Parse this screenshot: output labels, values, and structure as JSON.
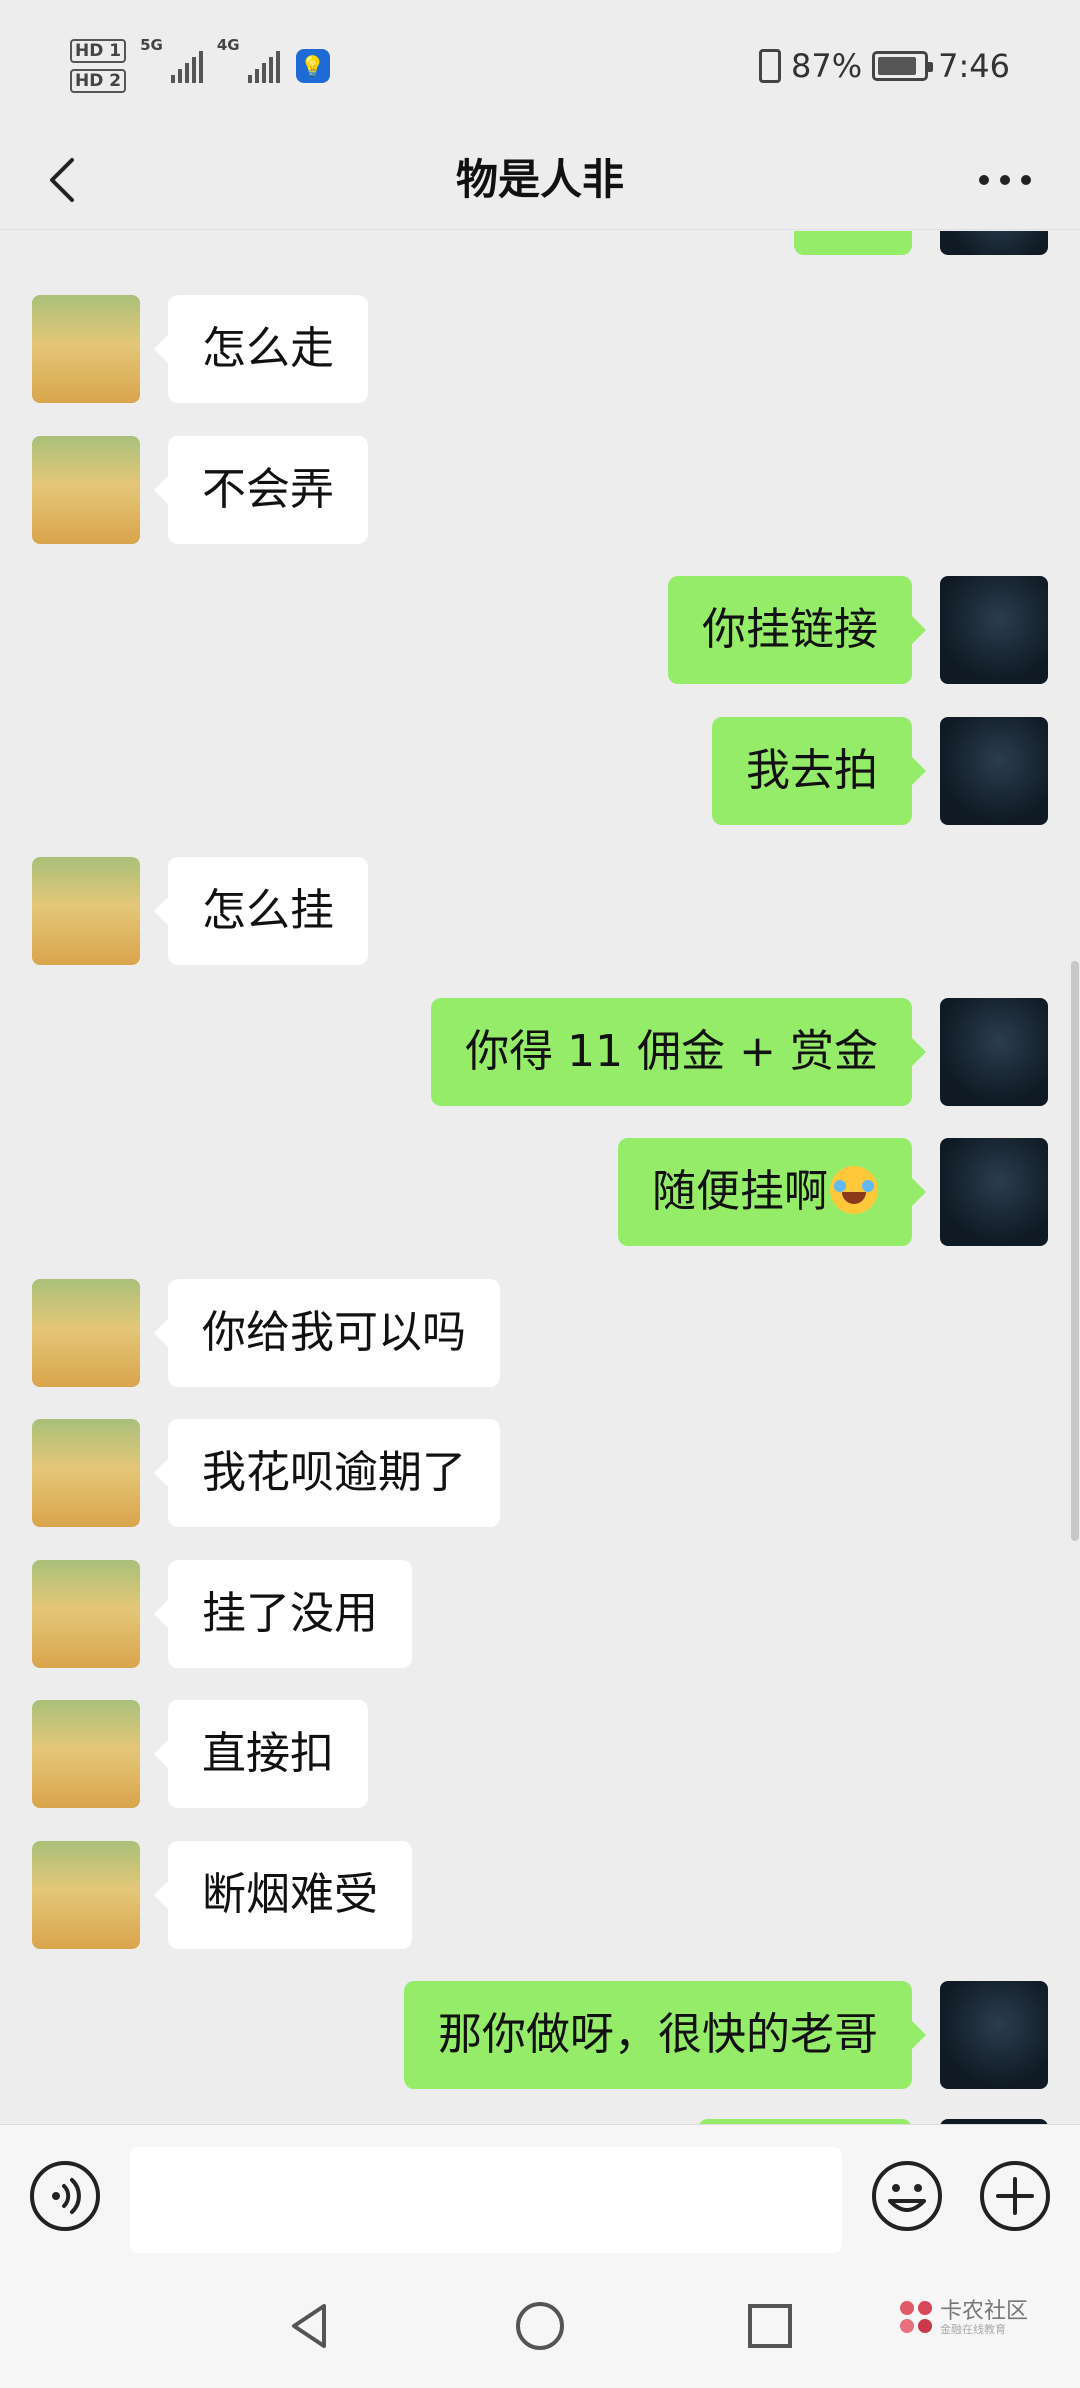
{
  "status_bar": {
    "hd1": "HD 1",
    "hd2": "HD 2",
    "network1": "5G",
    "network2": "4G",
    "battery_percent": "87%",
    "battery_level": 0.87,
    "time": "7:46"
  },
  "header": {
    "title": "物是人非",
    "back_icon": "chevron-left-icon",
    "more_icon": "more-horizontal-icon"
  },
  "messages": [
    {
      "side": "left",
      "text": "怎么走"
    },
    {
      "side": "left",
      "text": "不会弄"
    },
    {
      "side": "right",
      "text": "你挂链接"
    },
    {
      "side": "right",
      "text": "我去拍"
    },
    {
      "side": "left",
      "text": "怎么挂"
    },
    {
      "side": "right",
      "text": "你得 11 佣金 + 赏金"
    },
    {
      "side": "right",
      "text": "随便挂啊",
      "emoji": "laughing-crying-emoji"
    },
    {
      "side": "left",
      "text": "你给我可以吗"
    },
    {
      "side": "left",
      "text": "我花呗逾期了"
    },
    {
      "side": "left",
      "text": "挂了没用"
    },
    {
      "side": "left",
      "text": "直接扣"
    },
    {
      "side": "left",
      "text": "断烟难受"
    },
    {
      "side": "right",
      "text": "那你做呀，很快的老哥"
    }
  ],
  "input_bar": {
    "value": "",
    "voice_icon": "voice-icon",
    "emoji_icon": "emoji-icon",
    "plus_icon": "plus-icon"
  },
  "system_nav": {
    "back_icon": "triangle-back-icon",
    "home_icon": "circle-home-icon",
    "recent_icon": "square-recent-icon"
  },
  "watermark": {
    "title": "卡农社区",
    "subtitle": "金融在线教育"
  },
  "colors": {
    "background": "#ededed",
    "sent_bubble": "#95ec69",
    "received_bubble": "#ffffff"
  }
}
